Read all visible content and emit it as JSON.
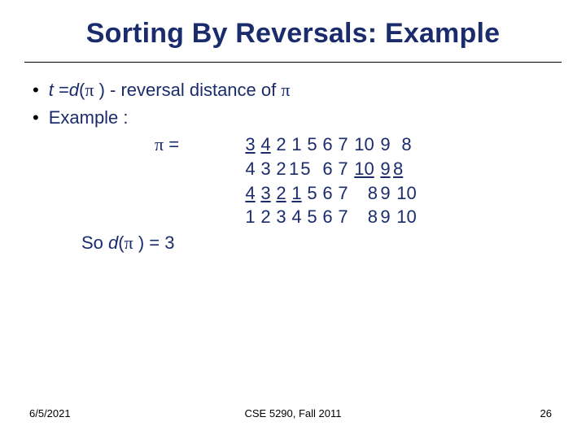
{
  "title": "Sorting By Reversals: Example",
  "bullets": {
    "b1a": "t",
    "b1b": " =",
    "b1c": "d",
    "b1d": "(",
    "b1e": " ) - reversal distance of ",
    "b2": "Example :"
  },
  "perm": {
    "lead_pi": "π",
    "lead_eq": "  =",
    "rows": [
      {
        "cells": [
          "3",
          "4",
          "2",
          "1",
          "5",
          "6",
          "7",
          "10",
          "9",
          "8"
        ],
        "underline": [
          0,
          1
        ]
      },
      {
        "cells": [
          "4",
          "3",
          "2",
          "1",
          "5",
          "6",
          "7",
          "10",
          "9",
          "8"
        ],
        "underline": [
          7,
          8,
          9
        ],
        "tight34": true
      },
      {
        "cells": [
          "4",
          "3",
          "2",
          "1",
          "5",
          "6",
          "7",
          "8",
          "9",
          "10"
        ],
        "underline": [
          0,
          1,
          2,
          3
        ]
      },
      {
        "cells": [
          "1",
          "2",
          "3",
          "4",
          "5",
          "6",
          "7",
          "8",
          "9",
          "10"
        ],
        "underline": []
      }
    ]
  },
  "so": {
    "a": "So ",
    "b": "d",
    "c": "(",
    "d": " ) = 3"
  },
  "footer": {
    "date": "6/5/2021",
    "course": "CSE 5290, Fall 2011",
    "page": "26"
  },
  "pi_char": "π"
}
